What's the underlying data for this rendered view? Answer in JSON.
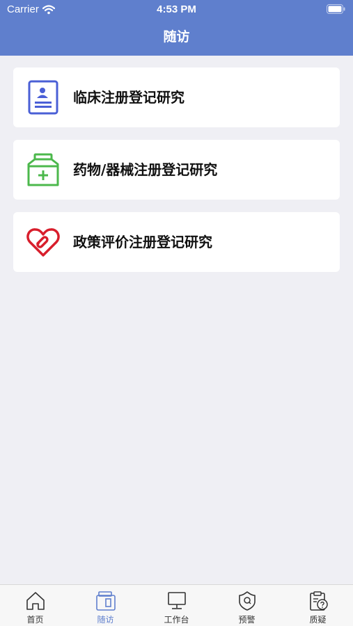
{
  "status_bar": {
    "carrier": "Carrier",
    "time": "4:53 PM"
  },
  "nav": {
    "title": "随访"
  },
  "cards": [
    {
      "label": "临床注册登记研究",
      "icon": "clinical-document-icon",
      "color": "#4a5fd6"
    },
    {
      "label": "药物/器械注册登记研究",
      "icon": "medicine-bottle-icon",
      "color": "#4cb84c"
    },
    {
      "label": "政策评价注册登记研究",
      "icon": "heart-link-icon",
      "color": "#d81e2c"
    }
  ],
  "tabbar": {
    "active_color": "#5f7fcd",
    "items": [
      {
        "label": "首页",
        "icon": "home-icon"
      },
      {
        "label": "随访",
        "icon": "followup-icon",
        "active": true
      },
      {
        "label": "工作台",
        "icon": "monitor-icon"
      },
      {
        "label": "预警",
        "icon": "shield-alert-icon"
      },
      {
        "label": "质疑",
        "icon": "clipboard-question-icon"
      }
    ]
  }
}
